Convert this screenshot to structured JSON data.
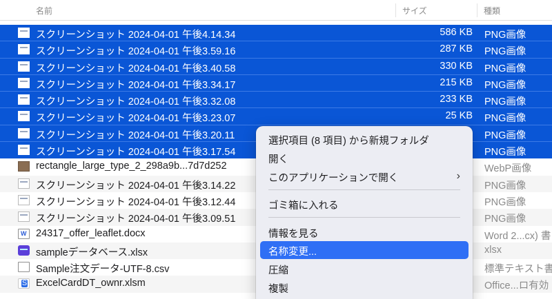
{
  "columns": {
    "name": "名前",
    "size": "サイズ",
    "kind": "種類"
  },
  "files": [
    {
      "name": "スクリーンショット 2024-04-01 午後4.14.34",
      "size": "586 KB",
      "kind": "PNG画像"
    },
    {
      "name": "スクリーンショット 2024-04-01 午後3.59.16",
      "size": "287 KB",
      "kind": "PNG画像"
    },
    {
      "name": "スクリーンショット 2024-04-01 午後3.40.58",
      "size": "330 KB",
      "kind": "PNG画像"
    },
    {
      "name": "スクリーンショット 2024-04-01 午後3.34.17",
      "size": "215 KB",
      "kind": "PNG画像"
    },
    {
      "name": "スクリーンショット 2024-04-01 午後3.32.08",
      "size": "233 KB",
      "kind": "PNG画像"
    },
    {
      "name": "スクリーンショット 2024-04-01 午後3.23.07",
      "size": "25 KB",
      "kind": "PNG画像"
    },
    {
      "name": "スクリーンショット 2024-04-01 午後3.20.11",
      "size": "",
      "kind": "PNG画像"
    },
    {
      "name": "スクリーンショット 2024-04-01 午後3.17.54",
      "size": "",
      "kind": "PNG画像"
    },
    {
      "name": "rectangle_large_type_2_298a9b...7d7d252",
      "size": "",
      "kind": "WebP画像"
    },
    {
      "name": "スクリーンショット 2024-04-01 午後3.14.22",
      "size": "",
      "kind": "PNG画像"
    },
    {
      "name": "スクリーンショット 2024-04-01 午後3.12.44",
      "size": "",
      "kind": "PNG画像"
    },
    {
      "name": "スクリーンショット 2024-04-01 午後3.09.51",
      "size": "",
      "kind": "PNG画像"
    },
    {
      "name": "24317_offer_leaflet.docx",
      "size": "",
      "kind": "Word 2...cx) 書"
    },
    {
      "name": "sampleデータベース.xlsx",
      "size": "",
      "kind": "xlsx"
    },
    {
      "name": "Sample注文データ-UTF-8.csv",
      "size": "",
      "kind": "標準テキスト書"
    },
    {
      "name": "ExcelCardDT_ownr.xlsm",
      "size": "",
      "kind": "Office...ロ有効"
    }
  ],
  "context_menu": {
    "new_folder_from_selection": "選択項目 (8 項目) から新規フォルダ",
    "open": "開く",
    "open_with": "このアプリケーションで開く",
    "move_to_trash": "ゴミ箱に入れる",
    "get_info": "情報を見る",
    "rename": "名称変更...",
    "compress": "圧縮",
    "duplicate": "複製"
  },
  "colors": {
    "selection": "#0a56d6",
    "menu_highlight": "#2f6ff5",
    "menu_background": "#ecedf3"
  }
}
